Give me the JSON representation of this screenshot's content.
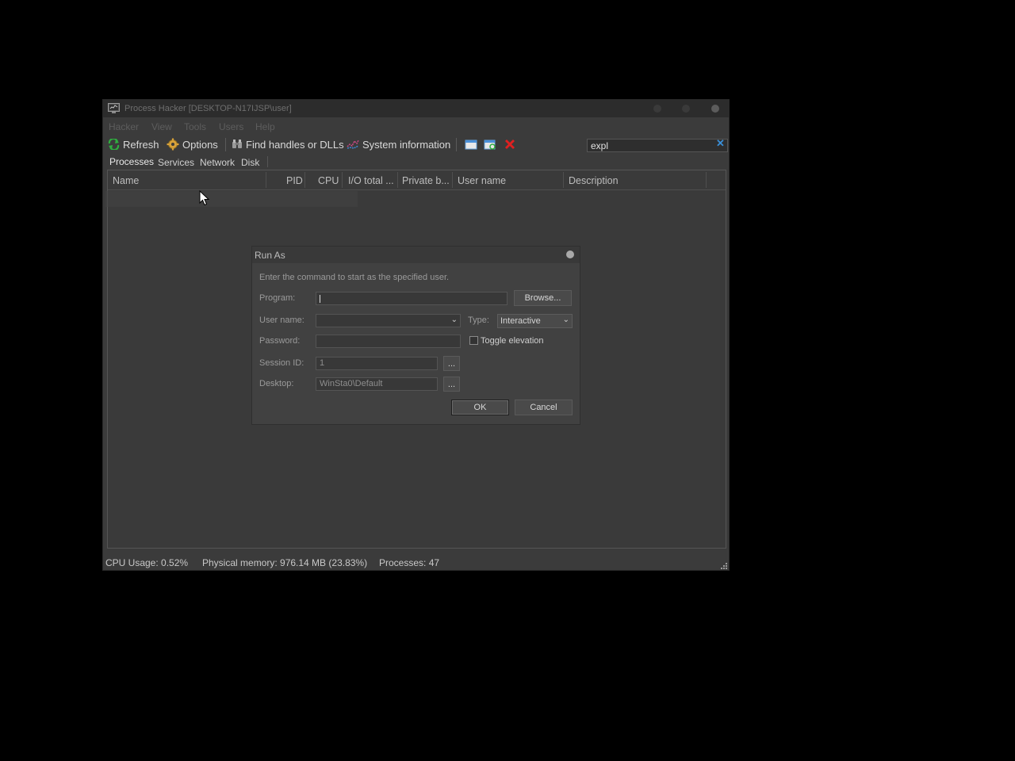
{
  "window": {
    "title": "Process Hacker [DESKTOP-N17IJSP\\user]",
    "menu": [
      "Hacker",
      "View",
      "Tools",
      "Users",
      "Help"
    ],
    "toolbar": {
      "refresh": "Refresh",
      "options": "Options",
      "find_handles": "Find handles or DLLs",
      "system_information": "System information",
      "search_value": "expl"
    },
    "tabs": [
      "Processes",
      "Services",
      "Network",
      "Disk"
    ],
    "columns": [
      "Name",
      "PID",
      "CPU",
      "I/O total ...",
      "Private b...",
      "User name",
      "Description"
    ],
    "status": {
      "cpu": "CPU Usage: 0.52%",
      "memory": "Physical memory: 976.14 MB (23.83%)",
      "processes": "Processes: 47"
    }
  },
  "dialog": {
    "title": "Run As",
    "instruction": "Enter the command to start as the specified user.",
    "program_label": "Program:",
    "program_value": "",
    "browse_label": "Browse...",
    "username_label": "User name:",
    "username_value": "",
    "type_label": "Type:",
    "type_value": "Interactive",
    "password_label": "Password:",
    "toggle_elevation_label": "Toggle elevation",
    "toggle_elevation_checked": false,
    "session_label": "Session ID:",
    "session_value": "1",
    "desktop_label": "Desktop:",
    "desktop_value": "WinSta0\\Default",
    "ellipsis": "...",
    "ok_label": "OK",
    "cancel_label": "Cancel"
  },
  "colors": {
    "background": "#000000",
    "window_bg": "#3b3b3b",
    "accent_close": "#e02020",
    "accent_refresh": "#2fae3f"
  }
}
